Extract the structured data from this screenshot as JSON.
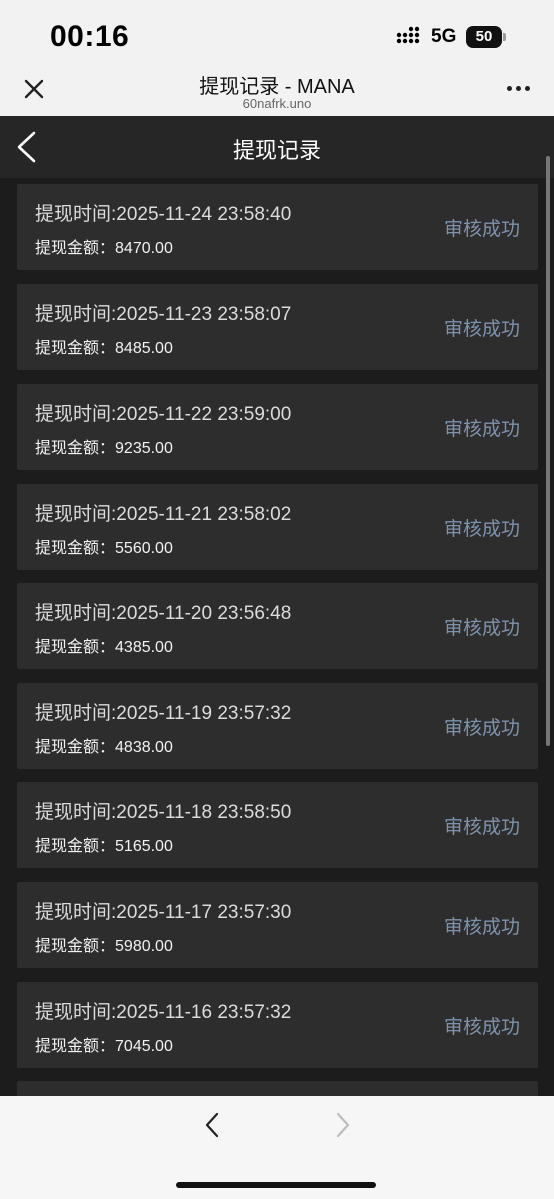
{
  "status_bar": {
    "time": "00:16",
    "network": "5G",
    "battery": "50"
  },
  "browser": {
    "title": "提现记录 - MANA",
    "url": "60nafrk.uno"
  },
  "page": {
    "title": "提现记录"
  },
  "records": [
    {
      "time_label": "提现时间:2025-11-24 23:58:40",
      "amount_label": "提现金额：",
      "amount": "8470.00",
      "status": "审核成功"
    },
    {
      "time_label": "提现时间:2025-11-23 23:58:07",
      "amount_label": "提现金额：",
      "amount": "8485.00",
      "status": "审核成功"
    },
    {
      "time_label": "提现时间:2025-11-22 23:59:00",
      "amount_label": "提现金额：",
      "amount": "9235.00",
      "status": "审核成功"
    },
    {
      "time_label": "提现时间:2025-11-21 23:58:02",
      "amount_label": "提现金额：",
      "amount": "5560.00",
      "status": "审核成功"
    },
    {
      "time_label": "提现时间:2025-11-20 23:56:48",
      "amount_label": "提现金额：",
      "amount": "4385.00",
      "status": "审核成功"
    },
    {
      "time_label": "提现时间:2025-11-19 23:57:32",
      "amount_label": "提现金额：",
      "amount": "4838.00",
      "status": "审核成功"
    },
    {
      "time_label": "提现时间:2025-11-18 23:58:50",
      "amount_label": "提现金额：",
      "amount": "5165.00",
      "status": "审核成功"
    },
    {
      "time_label": "提现时间:2025-11-17 23:57:30",
      "amount_label": "提现金额：",
      "amount": "5980.00",
      "status": "审核成功"
    },
    {
      "time_label": "提现时间:2025-11-16 23:57:32",
      "amount_label": "提现金额：",
      "amount": "7045.00",
      "status": "审核成功"
    }
  ],
  "colors": {
    "page_background": "#1c1c1c",
    "card_background": "#2d2d2d",
    "status_accent": "#7d93ac"
  },
  "icons": [
    "signal-icon",
    "battery-icon",
    "close-icon",
    "more-icon",
    "back-icon",
    "prev-icon",
    "next-icon"
  ]
}
